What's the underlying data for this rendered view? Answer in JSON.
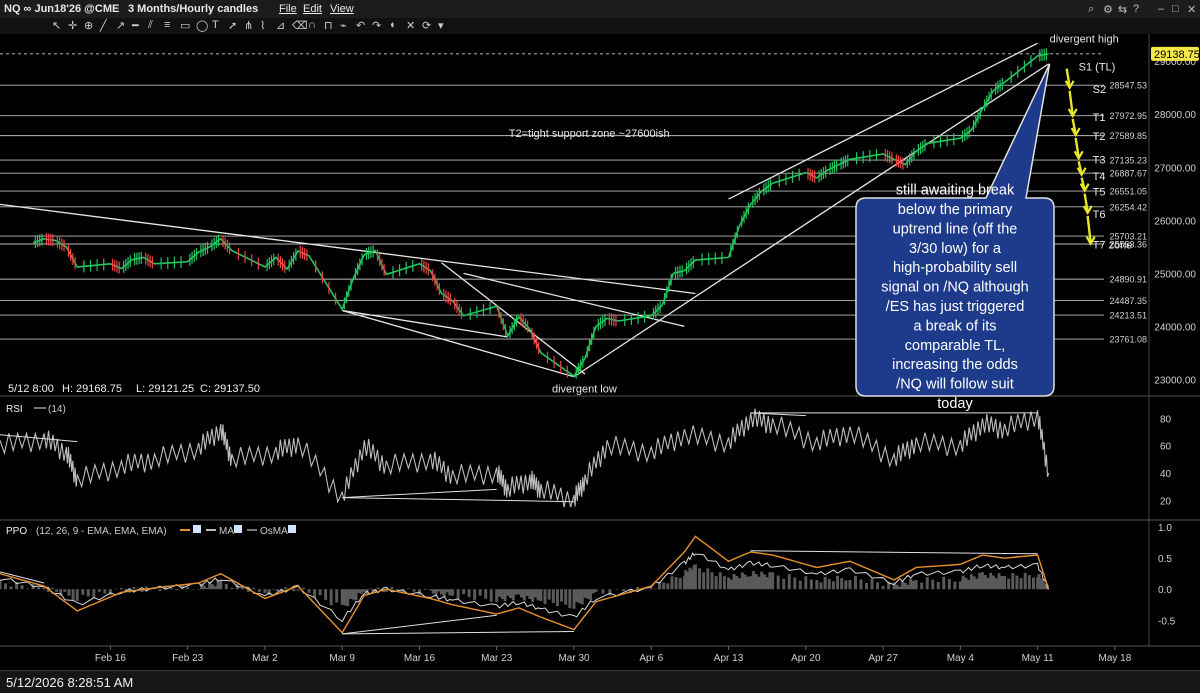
{
  "window": {
    "symbol": "NQ ∞ Jun18'26 @CME",
    "timeframe": "3 Months/Hourly candles",
    "menus": [
      "File",
      "Edit",
      "View"
    ]
  },
  "status_bar": {
    "datetime": "5/12/2026 8:28:51 AM"
  },
  "colors": {
    "background": "#000000",
    "up_candle": "#22c55e",
    "down_candle": "#ef4444",
    "price_marker": "#f5e64a",
    "callout_bg": "#1e3a8a",
    "ppo_line": "#e8912d",
    "arrow": "#e6e62a"
  },
  "chart_data": {
    "type": "line",
    "title": "",
    "price_panel": {
      "ylim": [
        22800,
        29400
      ],
      "y_ticks": [
        23000,
        24000,
        25000,
        26000,
        27000,
        28000,
        29000
      ],
      "y_tick_labels": [
        "23000.00",
        "24000.00",
        "25000.00",
        "26000.00",
        "27000.00",
        "28000.00",
        "29000.00"
      ],
      "last_price": 29138.75,
      "last_price_label": "29138.75",
      "ohlc_readout": {
        "bar": "5/12 8:00",
        "high_label": "H: 29168.75",
        "low_label": "L: 29121.25",
        "close_label": "C: 29137.50"
      },
      "horizontal_levels": [
        {
          "value": 29138.75,
          "label": "",
          "style": "dashed"
        },
        {
          "value": 28547.53,
          "label": "28547.53"
        },
        {
          "value": 27972.95,
          "label": "27972.95"
        },
        {
          "value": 27596.8,
          "label": "27589.85"
        },
        {
          "value": 27135.23,
          "label": "27135.23"
        },
        {
          "value": 26887.67,
          "label": "26887.67"
        },
        {
          "value": 26551.05,
          "label": "26551.05"
        },
        {
          "value": 26254.42,
          "label": "26254.42"
        },
        {
          "value": 25703.21,
          "label": "25703.21"
        },
        {
          "value": 25553.36,
          "label": "25553.36"
        },
        {
          "value": 24890.91,
          "label": "24890.91"
        },
        {
          "value": 24487.35,
          "label": "24487.35"
        },
        {
          "value": 24213.51,
          "label": "24213.51"
        },
        {
          "value": 23761.08,
          "label": "23761.08"
        }
      ],
      "target_labels": [
        {
          "text": "S1 (TL)",
          "price": 28900
        },
        {
          "text": "S2",
          "price": 28480
        },
        {
          "text": "T1",
          "price": 27950
        },
        {
          "text": "T2",
          "price": 27590
        },
        {
          "text": "T3",
          "price": 27150
        },
        {
          "text": "T4",
          "price": 26840
        },
        {
          "text": "T5",
          "price": 26540
        },
        {
          "text": "T6",
          "price": 26120
        },
        {
          "text": "T7 zone",
          "price": 25540
        }
      ],
      "annotations": {
        "support_zone": "T2=tight support zone ~27600ish",
        "divergent_high": "divergent high",
        "divergent_low": "divergent low",
        "callout": "still awaiting break below the primary uptrend line (off the 3/30 low) for a high-probability sell signal on /NQ although /ES has just triggered a break of its comparable TL, increasing the odds /NQ will follow suit today"
      },
      "price_path": [
        [
          "02-09",
          25580
        ],
        [
          "02-10",
          25650
        ],
        [
          "02-11",
          25620
        ],
        [
          "02-12",
          25500
        ],
        [
          "02-13",
          25120
        ],
        [
          "02-16",
          25180
        ],
        [
          "02-17",
          25090
        ],
        [
          "02-18",
          25260
        ],
        [
          "02-19",
          25300
        ],
        [
          "02-20",
          25180
        ],
        [
          "02-23",
          25220
        ],
        [
          "02-24",
          25400
        ],
        [
          "02-25",
          25500
        ],
        [
          "02-26",
          25650
        ],
        [
          "02-27",
          25430
        ],
        [
          "03-02",
          25120
        ],
        [
          "03-03",
          25300
        ],
        [
          "03-04",
          25080
        ],
        [
          "03-05",
          25420
        ],
        [
          "03-06",
          25330
        ],
        [
          "03-09",
          24320
        ],
        [
          "03-10",
          24900
        ],
        [
          "03-11",
          25350
        ],
        [
          "03-12",
          25430
        ],
        [
          "03-13",
          24980
        ],
        [
          "03-16",
          25180
        ],
        [
          "03-17",
          25050
        ],
        [
          "03-18",
          24620
        ],
        [
          "03-19",
          24480
        ],
        [
          "03-20",
          24200
        ],
        [
          "03-23",
          24380
        ],
        [
          "03-24",
          23820
        ],
        [
          "03-25",
          24180
        ],
        [
          "03-26",
          23950
        ],
        [
          "03-27",
          23500
        ],
        [
          "03-30",
          23060
        ],
        [
          "03-31",
          23400
        ],
        [
          "04-01",
          24000
        ],
        [
          "04-02",
          24150
        ],
        [
          "04-03",
          24100
        ],
        [
          "04-06",
          24200
        ],
        [
          "04-07",
          24400
        ],
        [
          "04-08",
          25000
        ],
        [
          "04-09",
          25050
        ],
        [
          "04-10",
          25250
        ],
        [
          "04-13",
          25300
        ],
        [
          "04-14",
          25900
        ],
        [
          "04-15",
          26300
        ],
        [
          "04-16",
          26550
        ],
        [
          "04-17",
          26700
        ],
        [
          "04-20",
          26900
        ],
        [
          "04-21",
          26800
        ],
        [
          "04-22",
          26950
        ],
        [
          "04-23",
          27050
        ],
        [
          "04-24",
          27150
        ],
        [
          "04-27",
          27250
        ],
        [
          "04-28",
          27150
        ],
        [
          "04-29",
          27050
        ],
        [
          "04-30",
          27300
        ],
        [
          "05-01",
          27450
        ],
        [
          "05-04",
          27550
        ],
        [
          "05-05",
          27700
        ],
        [
          "05-06",
          28100
        ],
        [
          "05-07",
          28450
        ],
        [
          "05-08",
          28600
        ],
        [
          "05-11",
          29100
        ],
        [
          "05-12",
          29138.75
        ]
      ],
      "trendlines": [
        {
          "from": [
            "02-06",
            26300
          ],
          "to": [
            "04-10",
            24620
          ]
        },
        {
          "from": [
            "03-30",
            23050
          ],
          "to": [
            "05-12",
            28950
          ]
        },
        {
          "from": [
            "04-13",
            26400
          ],
          "to": [
            "05-11",
            29340
          ]
        },
        {
          "from": [
            "03-09",
            24300
          ],
          "to": [
            "03-24",
            23800
          ]
        },
        {
          "from": [
            "03-09",
            24300
          ],
          "to": [
            "03-30",
            23050
          ]
        },
        {
          "from": [
            "03-18",
            25200
          ],
          "to": [
            "03-31",
            23100
          ]
        },
        {
          "from": [
            "03-20",
            25000
          ],
          "to": [
            "04-09",
            24000
          ]
        }
      ],
      "arrow_targets": [
        "T1",
        "T2",
        "T3",
        "T4",
        "T5",
        "T6",
        "T7 zone"
      ]
    },
    "rsi_panel": {
      "label": "RSI",
      "params": "(14)",
      "ylim": [
        10,
        92
      ],
      "y_ticks": [
        20,
        40,
        60,
        80
      ],
      "path": [
        [
          "02-06",
          60
        ],
        [
          "02-10",
          65
        ],
        [
          "02-12",
          55
        ],
        [
          "02-13",
          35
        ],
        [
          "02-17",
          45
        ],
        [
          "02-20",
          50
        ],
        [
          "02-24",
          58
        ],
        [
          "02-26",
          72
        ],
        [
          "02-27",
          50
        ],
        [
          "03-03",
          55
        ],
        [
          "03-05",
          62
        ],
        [
          "03-09",
          22
        ],
        [
          "03-11",
          60
        ],
        [
          "03-13",
          45
        ],
        [
          "03-17",
          50
        ],
        [
          "03-19",
          38
        ],
        [
          "03-23",
          40
        ],
        [
          "03-24",
          28
        ],
        [
          "03-26",
          35
        ],
        [
          "03-27",
          28
        ],
        [
          "03-30",
          20
        ],
        [
          "03-31",
          35
        ],
        [
          "04-02",
          60
        ],
        [
          "04-06",
          55
        ],
        [
          "04-09",
          68
        ],
        [
          "04-13",
          62
        ],
        [
          "04-15",
          80
        ],
        [
          "04-17",
          76
        ],
        [
          "04-21",
          62
        ],
        [
          "04-24",
          70
        ],
        [
          "04-28",
          50
        ],
        [
          "04-30",
          62
        ],
        [
          "05-04",
          60
        ],
        [
          "05-06",
          76
        ],
        [
          "05-08",
          72
        ],
        [
          "05-11",
          82
        ],
        [
          "05-12",
          40
        ]
      ]
    },
    "ppo_panel": {
      "label": "PPO",
      "params": "(12, 26, 9 - EMA, EMA, EMA)",
      "legend": [
        "MA",
        "OsMA"
      ],
      "ylim": [
        -0.85,
        1.05
      ],
      "y_ticks": [
        -0.5,
        0.0,
        0.5,
        1.0
      ],
      "y_tick_labels": [
        "-0.5",
        "0.0",
        "0.5",
        "1.0"
      ],
      "ppo": [
        [
          "02-06",
          0.25
        ],
        [
          "02-10",
          0.05
        ],
        [
          "02-13",
          -0.35
        ],
        [
          "02-17",
          -0.05
        ],
        [
          "02-20",
          0.02
        ],
        [
          "02-24",
          0.1
        ],
        [
          "02-26",
          0.25
        ],
        [
          "03-02",
          -0.15
        ],
        [
          "03-05",
          0.05
        ],
        [
          "03-09",
          -0.7
        ],
        [
          "03-11",
          -0.1
        ],
        [
          "03-13",
          0.0
        ],
        [
          "03-17",
          -0.15
        ],
        [
          "03-19",
          -0.25
        ],
        [
          "03-23",
          -0.4
        ],
        [
          "03-25",
          -0.3
        ],
        [
          "03-27",
          -0.45
        ],
        [
          "03-30",
          -0.65
        ],
        [
          "04-01",
          -0.2
        ],
        [
          "04-06",
          0.05
        ],
        [
          "04-09",
          0.6
        ],
        [
          "04-10",
          0.85
        ],
        [
          "04-13",
          0.45
        ],
        [
          "04-15",
          0.6
        ],
        [
          "04-17",
          0.55
        ],
        [
          "04-21",
          0.35
        ],
        [
          "04-24",
          0.45
        ],
        [
          "04-28",
          0.15
        ],
        [
          "04-30",
          0.35
        ],
        [
          "05-04",
          0.4
        ],
        [
          "05-06",
          0.55
        ],
        [
          "05-08",
          0.5
        ],
        [
          "05-11",
          0.55
        ],
        [
          "05-12",
          0.0
        ]
      ]
    },
    "x_axis": {
      "ticks": [
        {
          "date": "02-16",
          "label": "Feb 16"
        },
        {
          "date": "02-23",
          "label": "Feb 23"
        },
        {
          "date": "03-02",
          "label": "Mar 2"
        },
        {
          "date": "03-09",
          "label": "Mar 9"
        },
        {
          "date": "03-16",
          "label": "Mar 16"
        },
        {
          "date": "03-23",
          "label": "Mar 23"
        },
        {
          "date": "03-30",
          "label": "Mar 30"
        },
        {
          "date": "04-06",
          "label": "Apr 6"
        },
        {
          "date": "04-13",
          "label": "Apr 13"
        },
        {
          "date": "04-20",
          "label": "Apr 20"
        },
        {
          "date": "04-27",
          "label": "Apr 27"
        },
        {
          "date": "05-04",
          "label": "May 4"
        },
        {
          "date": "05-11",
          "label": "May 11"
        },
        {
          "date": "05-18",
          "label": "May 18"
        }
      ],
      "range": [
        "02-06",
        "05-21"
      ]
    }
  }
}
